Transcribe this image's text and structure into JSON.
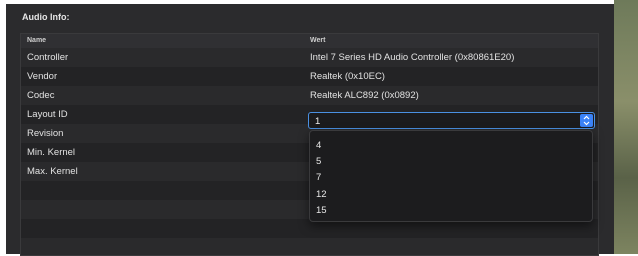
{
  "section_title": "Audio Info:",
  "table": {
    "headers": [
      "Name",
      "Wert"
    ],
    "rows": [
      {
        "name": "Controller",
        "value": "Intel 7 Series HD Audio Controller (0x80861E20)"
      },
      {
        "name": "Vendor",
        "value": "Realtek (0x10EC)"
      },
      {
        "name": "Codec",
        "value": "Realtek ALC892 (0x0892)"
      },
      {
        "name": "Layout ID",
        "value": ""
      },
      {
        "name": "Revision",
        "value": ""
      },
      {
        "name": "Min. Kernel",
        "value": ""
      },
      {
        "name": "Max. Kernel",
        "value": ""
      }
    ]
  },
  "layout_select": {
    "selected": "1",
    "options": [
      "4",
      "5",
      "7",
      "12",
      "15"
    ]
  },
  "colors": {
    "accent": "#3b82f6",
    "background": "#2b2b2d"
  }
}
